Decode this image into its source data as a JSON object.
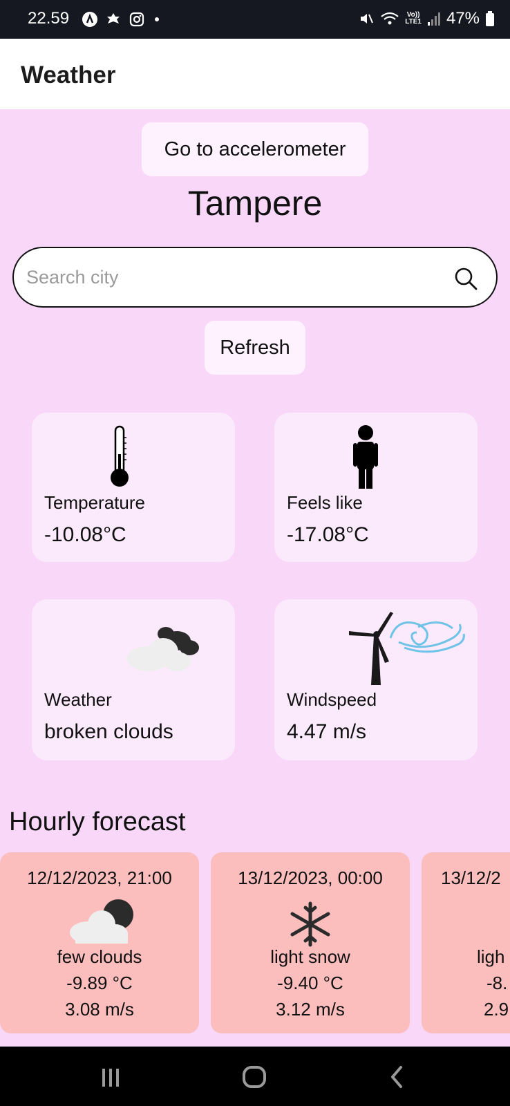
{
  "status_bar": {
    "time": "22.59",
    "battery": "47%",
    "network": "LTE1",
    "volte": "Vo))"
  },
  "app_bar": {
    "title": "Weather"
  },
  "buttons": {
    "accelerometer": "Go to accelerometer",
    "refresh": "Refresh"
  },
  "city": "Tampere",
  "search": {
    "placeholder": "Search city",
    "value": ""
  },
  "cards": {
    "temperature": {
      "label": "Temperature",
      "value": "-10.08°C",
      "icon": "thermometer-icon"
    },
    "feels_like": {
      "label": "Feels like",
      "value": "-17.08°C",
      "icon": "person-icon"
    },
    "weather": {
      "label": "Weather",
      "value": "broken clouds",
      "icon": "broken-clouds-icon"
    },
    "windspeed": {
      "label": "Windspeed",
      "value": "4.47 m/s",
      "icon": "wind-turbine-icon"
    }
  },
  "hourly": {
    "title": "Hourly forecast",
    "items": [
      {
        "date": "12/12/2023, 21:00",
        "desc": "few clouds",
        "temp": "-9.89 °C",
        "wind": "3.08 m/s",
        "icon": "few-clouds-night-icon"
      },
      {
        "date": "13/12/2023, 00:00",
        "desc": "light snow",
        "temp": "-9.40 °C",
        "wind": "3.12 m/s",
        "icon": "snowflake-icon"
      },
      {
        "date": "13/12/2",
        "desc": "ligh",
        "temp": "-8.",
        "wind": "2.9",
        "icon": "weather-icon"
      }
    ]
  },
  "colors": {
    "background": "#f8d7f9",
    "card": "#fbeafc",
    "hourly_card": "#fcbdbd",
    "button": "#fdf2fd"
  }
}
